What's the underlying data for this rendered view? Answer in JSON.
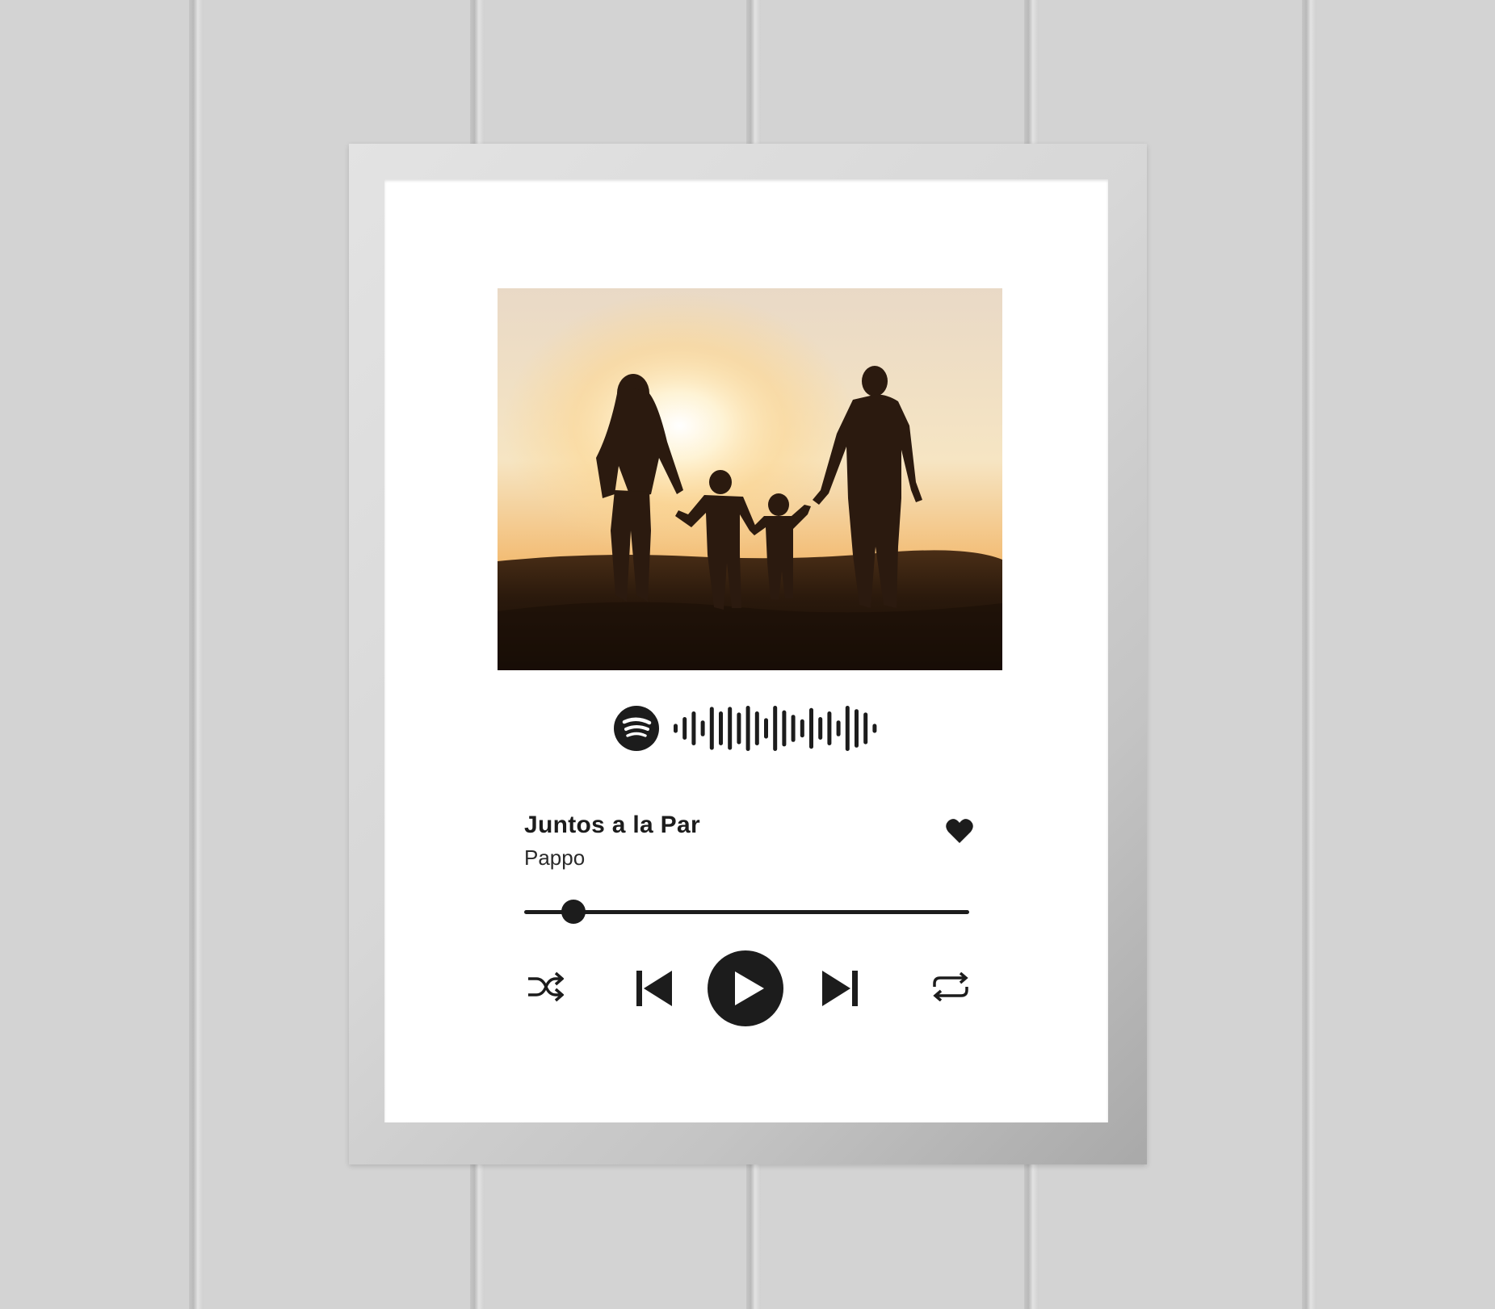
{
  "track": {
    "title": "Juntos a la Par",
    "artist": "Pappo",
    "progress": 0.11
  },
  "icons": {
    "brand": "spotify-icon",
    "favorite": "heart-icon",
    "shuffle": "shuffle-icon",
    "previous": "skip-previous-icon",
    "play": "play-icon",
    "next": "skip-next-icon",
    "repeat": "repeat-icon"
  },
  "colors": {
    "ink": "#1c1c1c",
    "mat": "#ffffff",
    "frame": "#d6d6d6",
    "wall": "#d3d3d3"
  }
}
